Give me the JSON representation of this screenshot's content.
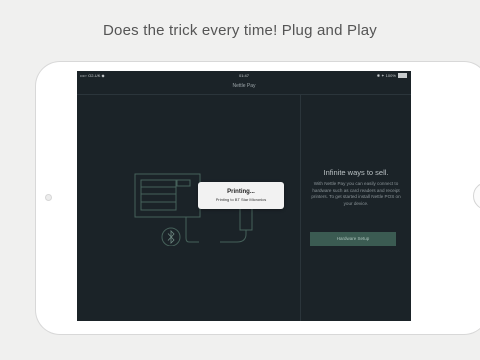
{
  "headline": "Does the trick every time! Plug and Play",
  "statusbar": {
    "carrier": "••••◦ O2-UK ◆",
    "time": "01:47",
    "battery_text": "✱ ✦ 100%"
  },
  "nav": {
    "title": "Nettle Pay"
  },
  "toast": {
    "title": "Printing...",
    "subtitle": "Printing to BT Star Micronics"
  },
  "panel": {
    "title": "Infinite ways to sell.",
    "body": "With Nettle Pay you can easily connect to hardware such as card readers and receipt printers. To get started install Nettle POS on your device.",
    "button": "Hardware Setup"
  },
  "icons": {
    "illustration": "pos-terminal-icon",
    "bluetooth": "bluetooth-icon",
    "battery": "battery-icon"
  },
  "colors": {
    "screen_bg": "#1b2328",
    "line": "#46615a",
    "button_bg": "#3b5b52"
  }
}
